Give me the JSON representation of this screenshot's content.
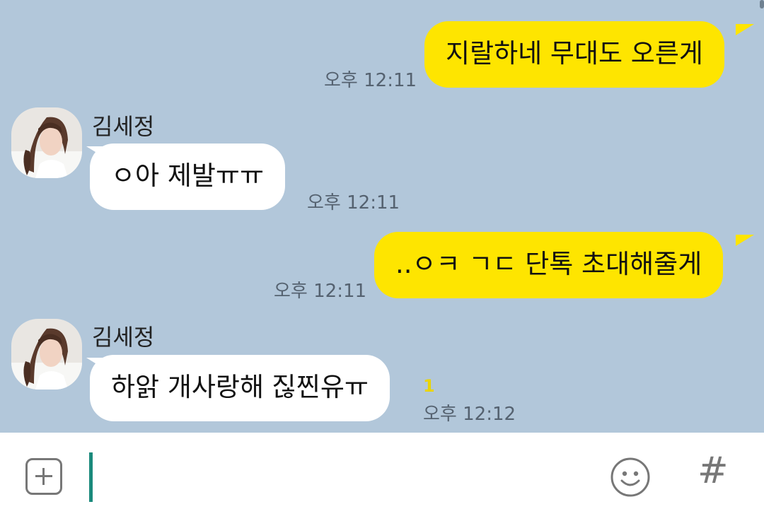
{
  "messages": [
    {
      "type": "sent",
      "text": "지랄하네 무대도 오른게",
      "time": "오후 12:11"
    },
    {
      "type": "received",
      "sender": "김세정",
      "text": "ㅇ아 제발ㅠㅠ",
      "time": "오후 12:11"
    },
    {
      "type": "sent",
      "text": "..ㅇㅋ ㄱㄷ 단톡 초대해줄게",
      "time": "오후 12:11"
    },
    {
      "type": "received",
      "sender": "김세정",
      "text": "하앍 개사랑해 짆찐유ㅠ",
      "time": "오후 12:12",
      "unread": "1"
    }
  ],
  "input": {
    "add_icon": "plus-square-icon",
    "emoji_icon": "smiley-icon",
    "hash_label": "#"
  },
  "colors": {
    "background": "#b2c7da",
    "sent_bubble": "#fee500",
    "received_bubble": "#ffffff",
    "caret": "#1b8a7c"
  }
}
